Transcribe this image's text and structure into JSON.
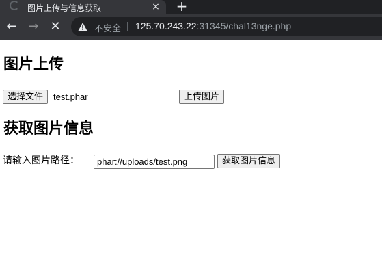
{
  "browser": {
    "tab_title": "图片上传与信息获取",
    "tab_close_icon": "×",
    "new_tab_icon": "+",
    "back_icon": "←",
    "forward_icon": "→",
    "stop_icon": "✕",
    "security_label": "不安全",
    "url_host": "125.70.243.22",
    "url_rest": ":31345/chal13nge.php"
  },
  "upload_section": {
    "heading": "图片上传",
    "choose_file_label": "选择文件",
    "file_name": "test.phar",
    "upload_button_label": "上传图片"
  },
  "info_section": {
    "heading": "获取图片信息",
    "path_label": "请输入图片路径：",
    "path_value": "phar://uploads/test.png",
    "get_info_button_label": "获取图片信息"
  }
}
